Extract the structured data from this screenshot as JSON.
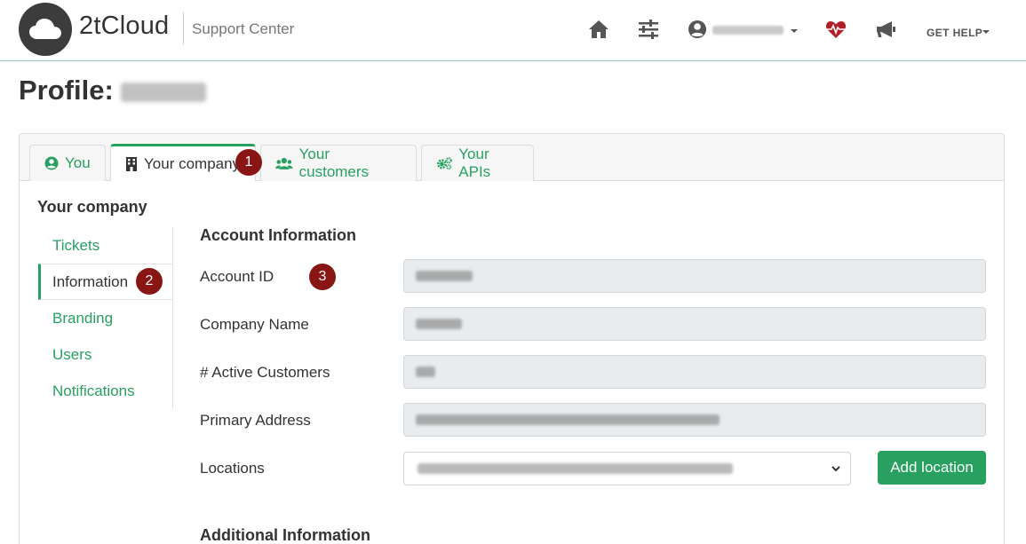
{
  "header": {
    "brand": "2tCloud",
    "subtitle": "Support Center",
    "user_name": "",
    "get_help": "GET HELP"
  },
  "page": {
    "title_prefix": "Profile:",
    "title_name": ""
  },
  "tabs": [
    {
      "label": "You",
      "icon": "user-circle-icon",
      "active": false
    },
    {
      "label": "Your company",
      "icon": "building-icon",
      "active": true
    },
    {
      "label": "Your customers",
      "icon": "users-icon",
      "active": false
    },
    {
      "label": "Your APIs",
      "icon": "cogs-icon",
      "active": false
    }
  ],
  "sidebar": {
    "title": "Your company",
    "items": [
      {
        "label": "Tickets",
        "active": false
      },
      {
        "label": "Information",
        "active": true
      },
      {
        "label": "Branding",
        "active": false
      },
      {
        "label": "Users",
        "active": false
      },
      {
        "label": "Notifications",
        "active": false
      }
    ]
  },
  "form": {
    "section_title": "Account Information",
    "fields": [
      {
        "label": "Account ID",
        "value": ""
      },
      {
        "label": "Company Name",
        "value": ""
      },
      {
        "label": "# Active Customers",
        "value": ""
      },
      {
        "label": "Primary Address",
        "value": ""
      }
    ],
    "locations_label": "Locations",
    "locations_value": "",
    "add_location": "Add location",
    "additional_title": "Additional Information"
  },
  "markers": [
    "1",
    "2",
    "3"
  ],
  "colors": {
    "accent": "#28a060",
    "marker": "#8a1515",
    "heart": "#b0202a"
  }
}
